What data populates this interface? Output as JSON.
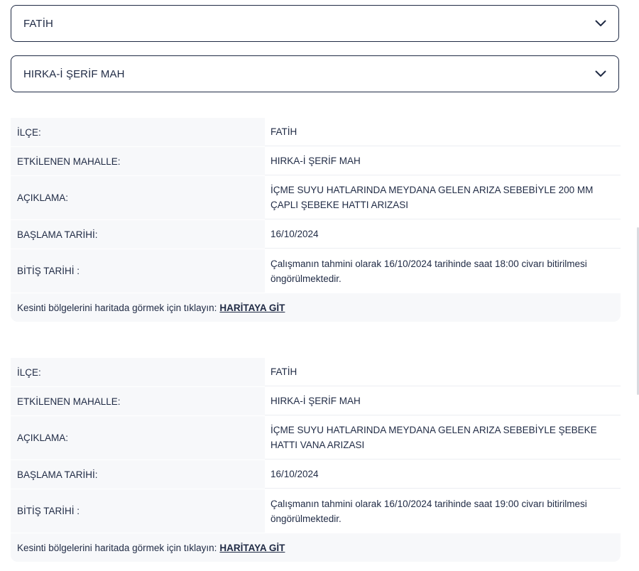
{
  "filters": {
    "district": "FATİH",
    "neighborhood": "HIRKA-İ ŞERİF MAH"
  },
  "icons": {
    "chevron": "chevron-down-icon"
  },
  "labels": {
    "district": "İLÇE:",
    "neighborhood": "ETKİLENEN MAHALLE:",
    "description": "AÇIKLAMA:",
    "start": "BAŞLAMA TARİHİ:",
    "end": "BİTİŞ TARİHİ :",
    "map_text": "Kesinti bölgelerini haritada görmek için tıklayın:",
    "map_link": "HARİTAYA GİT"
  },
  "outages": [
    {
      "district": "FATİH",
      "neighborhood": "HIRKA-İ ŞERİF MAH",
      "description": "İÇME SUYU HATLARINDA MEYDANA GELEN ARIZA SEBEBİYLE 200 MM ÇAPLI ŞEBEKE HATTI ARIZASI",
      "start": "16/10/2024",
      "end": "Çalışmanın tahmini olarak 16/10/2024 tarihinde saat 18:00 civarı bitirilmesi öngörülmektedir."
    },
    {
      "district": "FATİH",
      "neighborhood": "HIRKA-İ ŞERİF MAH",
      "description": "İÇME SUYU HATLARINDA MEYDANA GELEN ARIZA SEBEBİYLE ŞEBEKE HATTI VANA ARIZASI",
      "start": "16/10/2024",
      "end": "Çalışmanın tahmini olarak 16/10/2024 tarihinde saat 19:00 civarı bitirilmesi öngörülmektedir."
    }
  ]
}
